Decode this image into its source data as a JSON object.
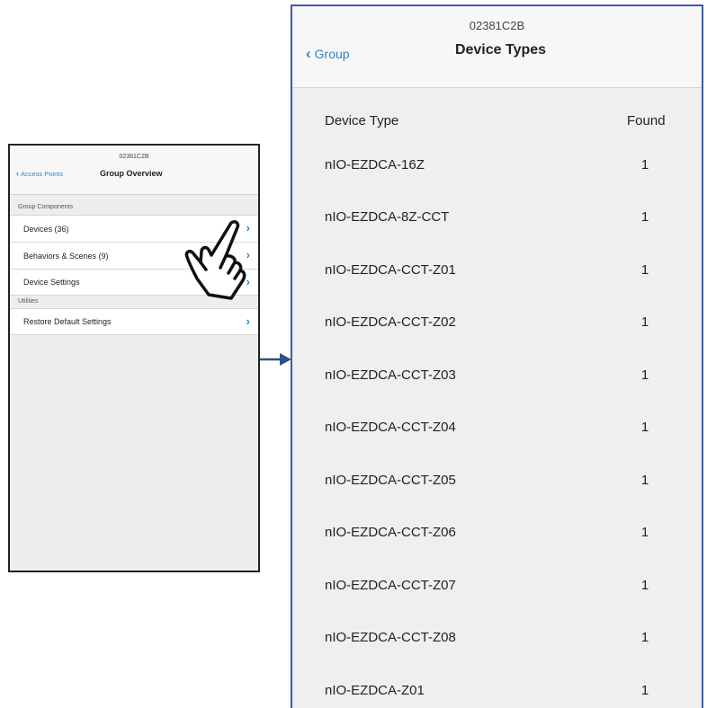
{
  "left_screen": {
    "subtitle": "02381C2B",
    "back_label": "Access Points",
    "title": "Group Overview",
    "sections": [
      {
        "header": "Group Components",
        "rows": [
          {
            "label": "Devices (36)"
          },
          {
            "label": "Behaviors & Scenes (9)"
          },
          {
            "label": "Device Settings"
          }
        ]
      },
      {
        "header": "Utilities",
        "rows": [
          {
            "label": "Restore Default Settings"
          }
        ]
      }
    ]
  },
  "right_screen": {
    "subtitle": "02381C2B",
    "back_label": "Group",
    "title": "Device Types",
    "columns": [
      "Device Type",
      "Found"
    ],
    "rows": [
      {
        "device_type": "nIO-EZDCA-16Z",
        "found": "1"
      },
      {
        "device_type": "nIO-EZDCA-8Z-CCT",
        "found": "1"
      },
      {
        "device_type": "nIO-EZDCA-CCT-Z01",
        "found": "1"
      },
      {
        "device_type": "nIO-EZDCA-CCT-Z02",
        "found": "1"
      },
      {
        "device_type": "nIO-EZDCA-CCT-Z03",
        "found": "1"
      },
      {
        "device_type": "nIO-EZDCA-CCT-Z04",
        "found": "1"
      },
      {
        "device_type": "nIO-EZDCA-CCT-Z05",
        "found": "1"
      },
      {
        "device_type": "nIO-EZDCA-CCT-Z06",
        "found": "1"
      },
      {
        "device_type": "nIO-EZDCA-CCT-Z07",
        "found": "1"
      },
      {
        "device_type": "nIO-EZDCA-CCT-Z08",
        "found": "1"
      },
      {
        "device_type": "nIO-EZDCA-Z01",
        "found": "1"
      }
    ]
  },
  "icons": {
    "back": "chevron-left-icon",
    "row_arrow": "chevron-right-icon",
    "pointer": "pointing-hand-icon",
    "connector": "arrow-right-icon"
  },
  "colors": {
    "accent": "#2c86c6",
    "frame_highlight": "#3b5aa8",
    "background": "#efefef"
  }
}
